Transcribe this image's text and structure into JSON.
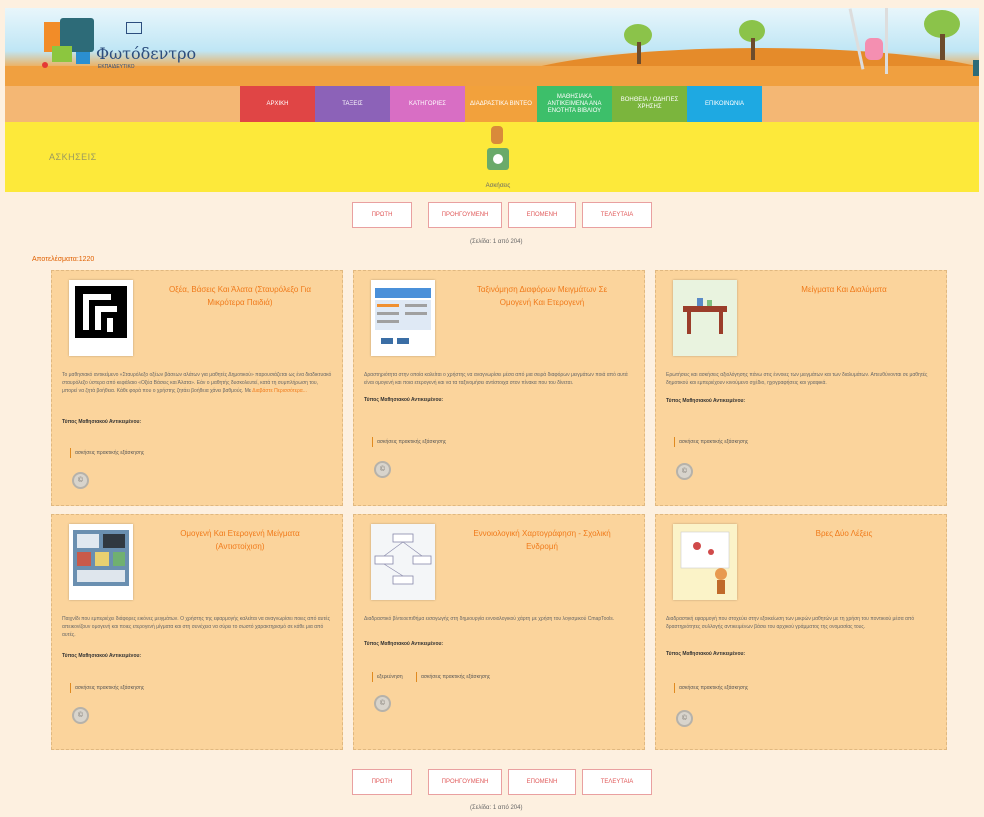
{
  "brand": {
    "name": "Φωτόδεντρο",
    "sub": "ΕΚΠΑΙΔΕΥΤΙΚΟ"
  },
  "nav": [
    {
      "label": "ΑΡΧΙΚΗ",
      "color": "#e04545"
    },
    {
      "label": "ΤΑΞΕΙΣ",
      "color": "#8c62b8"
    },
    {
      "label": "ΚΑΤΗΓΟΡΙΕΣ",
      "color": "#d86ec4"
    },
    {
      "label": "ΔΙΑΔΡΑΣΤΙΚΑ ΒΙΝΤΕΟ",
      "color": "#f2a13c"
    },
    {
      "label": "ΜΑΘΗΣΙΑΚΑ ΑΝΤΙΚΕΙΜΕΝΑ ΑΝΑ ΕΝΟΤΗΤΑ ΒΙΒΛΙΟΥ",
      "color": "#3dbf6a"
    },
    {
      "label": "ΒΟΗΘΕΙΑ / ΟΔΗΓΙΕΣ ΧΡΗΣΗΣ",
      "color": "#7bb53d"
    },
    {
      "label": "ΕΠΙΚΟΙΝΩΝΙΑ",
      "color": "#1ea9e2"
    }
  ],
  "band": {
    "title": "ΑΣΚΗΣΕΙΣ",
    "icon_label": "Ασκήσεις"
  },
  "pager": {
    "first": "ΠΡΩΤΗ",
    "prev": "ΠΡΟΗΓΟΥΜΕΝΗ",
    "next": "ΕΠΟΜΕΝΗ",
    "last": "ΤΕΛΕΥΤΑΙΑ",
    "info": "(Σελίδα: 1 από 204)"
  },
  "results": "Αποτελέσματα:1220",
  "type_label": "Τύπος Μαθησιακού Αντικειμένου:",
  "cards": [
    {
      "title": "Οξέα, Βάσεις Και Άλατα (Σταυρόλεξο Για Μικρότερα Παιδιά)",
      "desc": "Το μαθησιακό αντικείμενο «Σταυρόλεξο οξέων βάσεων αλάτων για μαθητές Δημοτικού» παρουσιάζεται ως ένα διαδικτυακό σταυρόλεξο ύστερα από κεφάλαιο «Οξέα Βάσεις και Άλατα». Εάν ο μαθητής δυσκολευτεί, κατά τη συμπλήρωση του, μπορεί να ζητά βοήθεια. Κάθε φορά που ο χρήστης ζητάει βοήθεια χάνει βαθμούς. Με",
      "more": "Διαβάστε Περισσότερα...",
      "tags": [
        "ασκήσεις πρακτικής εξάσκησης"
      ]
    },
    {
      "title": "Ταξινόμηση Διαφόρων Μειγμάτων Σε Ομογενή Και Ετερογενή",
      "desc": "Δραστηριότητα στην οποία καλείται ο χρήστης να αναγνωρίσει μέσα από μια σειρά διαφόρων μειγμάτων ποιά από αυτά είναι ομογενή και ποια ετερογενή και να τα ταξινομήσει αντίστοιχα στον πίνακα που του δίνεται.",
      "more": "",
      "tags": [
        "ασκήσεις πρακτικής εξάσκησης"
      ]
    },
    {
      "title": "Μείγματα Και Διαλύματα",
      "desc": "Ερωτήσεις και ασκήσεις αξιολόγησης πάνω στις έννοιες των μειγμάτων και των διαλυμάτων. Απευθύνονται σε μαθητές δημοτικού και εμπεριέχουν κινούμενο σχέδιο, ηχογραφήσεις και γραφικά.",
      "more": "",
      "tags": [
        "ασκήσεις πρακτικής εξάσκησης"
      ]
    },
    {
      "title": "Ομογενή Και Ετερογενή Μείγματα (Αντιστοίχιση)",
      "desc": "Παιχνίδι που εμπεριέχει διάφορες εικόνες μειγμάτων. Ο χρήστης της εφαρμογής καλείται να αναγνωρίσει ποιες από αυτές απεικονίζουν ομογενή και ποιες ετερογενή μίγματα και στη συνέχεια να σύρει το σωστό χαρακτηρισμό σε κάθε μια από αυτές.",
      "more": "",
      "tags": [
        "ασκήσεις πρακτικής εξάσκησης"
      ]
    },
    {
      "title": "Εννοιολογική Χαρτογράφηση - Σχολική Ενδρομή",
      "desc": "Διαδραστικό βίντεοεπιθήμα εισαγωγής στη δημιουργία εννοιολογικού χάρτη με χρήση του λογισμικού CmapTools.",
      "more": "",
      "tags": [
        "εξερεύνηση",
        "ασκήσεις πρακτικής εξάσκησης"
      ]
    },
    {
      "title": "Βρες Δύο Λέξεις",
      "desc": "Διαδραστική εφαρμογή που στοχεύει στην εξοικείωση των μικρών μαθητών με τη χρήση του ποντικιού μέσα από δραστηριότητες συλλογής αντικειμένων βάσει του αρχικού γράμματος της ονομασίας τους.",
      "more": "",
      "tags": [
        "ασκήσεις πρακτικής εξάσκησης"
      ]
    }
  ]
}
